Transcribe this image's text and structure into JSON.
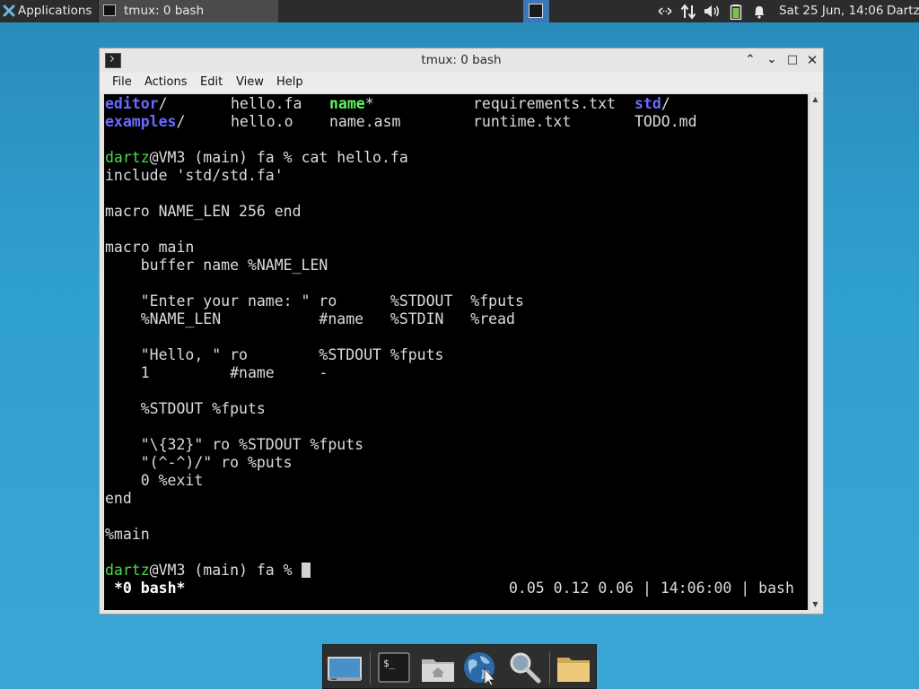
{
  "panel": {
    "apps_label": "Applications",
    "apps_icon": "xfce-logo-icon",
    "task_label": "tmux: 0 bash",
    "clock": "Sat 25 Jun, 14:06",
    "user": "Dartz",
    "tray_icons": [
      "network-arrows-icon",
      "transfer-arrows-icon",
      "volume-icon",
      "battery-icon",
      "notification-bell-icon"
    ]
  },
  "window": {
    "title": "tmux: 0 bash",
    "buttons": {
      "up": "⌃",
      "minimize": "⌄",
      "maximize": "□",
      "close": "✕"
    },
    "menu": [
      "File",
      "Actions",
      "Edit",
      "View",
      "Help"
    ]
  },
  "terminal": {
    "ls_row1": [
      "editor",
      "/",
      "hello.fa",
      "name",
      "*",
      "requirements.txt",
      "std",
      "/"
    ],
    "ls_row2": [
      "examples",
      "/",
      "hello.o",
      "name.asm",
      "runtime.txt",
      "TODO.md"
    ],
    "prompt_user": "dartz",
    "prompt_rest": "@VM3 (main) fa % ",
    "command": "cat hello.fa",
    "code_lines": [
      "include 'std/std.fa'",
      "",
      "macro NAME_LEN 256 end",
      "",
      "macro main",
      "    buffer name %NAME_LEN",
      "",
      "    \"Enter your name: \" ro      %STDOUT  %fputs",
      "    %NAME_LEN           #name   %STDIN   %read",
      "",
      "    \"Hello, \" ro        %STDOUT %fputs",
      "    1         #name     -",
      "",
      "    %STDOUT %fputs",
      "",
      "    \"\\{32}\" ro %STDOUT %fputs",
      "    \"(^-^)/\" ro %puts",
      "    0 %exit",
      "end",
      "",
      "%main",
      ""
    ],
    "status_left": "*0 bash*",
    "status_right": "0.05 0.12 0.06 | 14:06:00 | bash"
  },
  "dock": [
    "desktop-icon",
    "terminal-icon",
    "home-folder-icon",
    "web-browser-icon",
    "search-icon",
    "files-folder-icon"
  ]
}
